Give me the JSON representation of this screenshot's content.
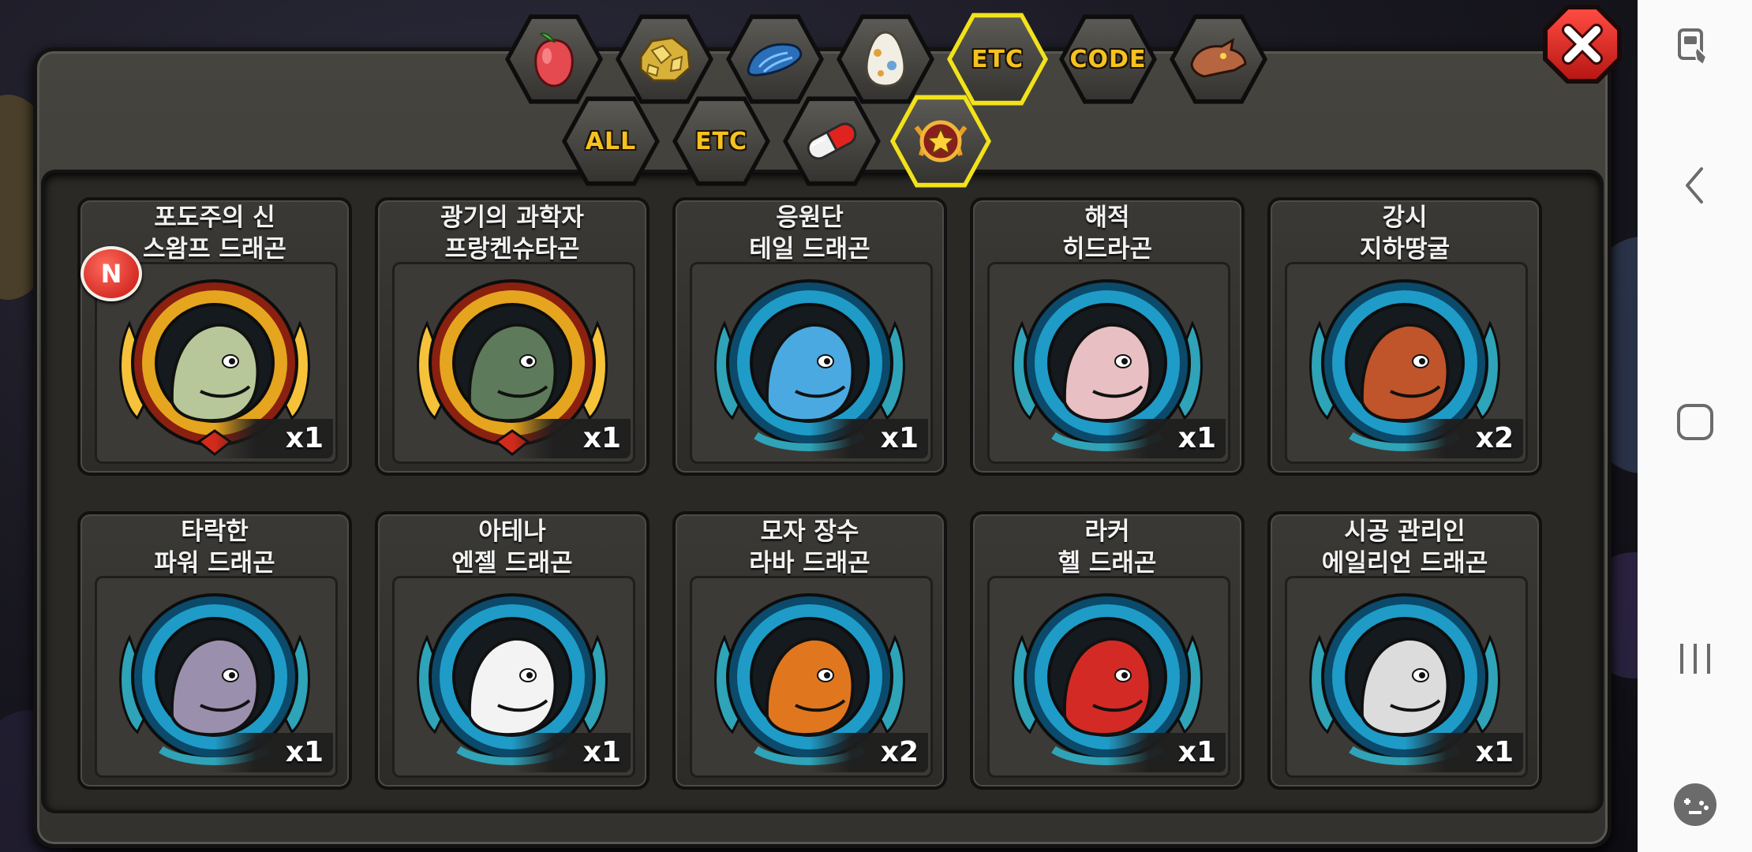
{
  "colors": {
    "accent": "#f2e21a",
    "tab_text": "#f6c21f",
    "close": "#e02a22",
    "navbar": "#fafafa"
  },
  "top_tabs": [
    {
      "icon": "fruit-icon"
    },
    {
      "icon": "gold-nugget-icon"
    },
    {
      "icon": "blue-scale-icon"
    },
    {
      "icon": "egg-icon"
    },
    {
      "label": "ETC",
      "active": true
    },
    {
      "label": "CODE"
    },
    {
      "icon": "dragon-head-icon"
    }
  ],
  "sub_tabs": [
    {
      "label": "ALL"
    },
    {
      "label": "ETC"
    },
    {
      "icon": "capsule-icon"
    },
    {
      "icon": "star-emblem-icon",
      "active": true
    }
  ],
  "cards": [
    {
      "name": "포도주의 신\n스왐프 드래곤",
      "qty": "x1",
      "frame": "gold",
      "new": true,
      "new_label": "N",
      "color": "#b7c79a"
    },
    {
      "name": "광기의 과학자\n프랑켄슈타곤",
      "qty": "x1",
      "frame": "gold",
      "color": "#5d7a5a"
    },
    {
      "name": "응원단\n테일 드래곤",
      "qty": "x1",
      "frame": "blue",
      "color": "#4aa9e0"
    },
    {
      "name": "해적\n히드라곤",
      "qty": "x1",
      "frame": "blue",
      "color": "#e8bfc3"
    },
    {
      "name": "강시\n지하땅굴",
      "qty": "x2",
      "frame": "blue",
      "color": "#c0542a"
    },
    {
      "name": "타락한\n파워 드래곤",
      "qty": "x1",
      "frame": "blue",
      "color": "#9a90ad"
    },
    {
      "name": "아테나\n엔젤 드래곤",
      "qty": "x1",
      "frame": "blue",
      "color": "#f3f3f3"
    },
    {
      "name": "모자 장수\n라바 드래곤",
      "qty": "x2",
      "frame": "blue",
      "color": "#e0771e"
    },
    {
      "name": "라커\n헬 드래곤",
      "qty": "x1",
      "frame": "blue",
      "color": "#d42a25"
    },
    {
      "name": "시공 관리인\n에일리언 드래곤",
      "qty": "x1",
      "frame": "blue",
      "color": "#dcdcdc"
    }
  ],
  "navbar": {
    "items": [
      "game-controller-lock-icon",
      "back-icon",
      "home-icon",
      "recents-icon",
      "game-tools-icon"
    ]
  }
}
